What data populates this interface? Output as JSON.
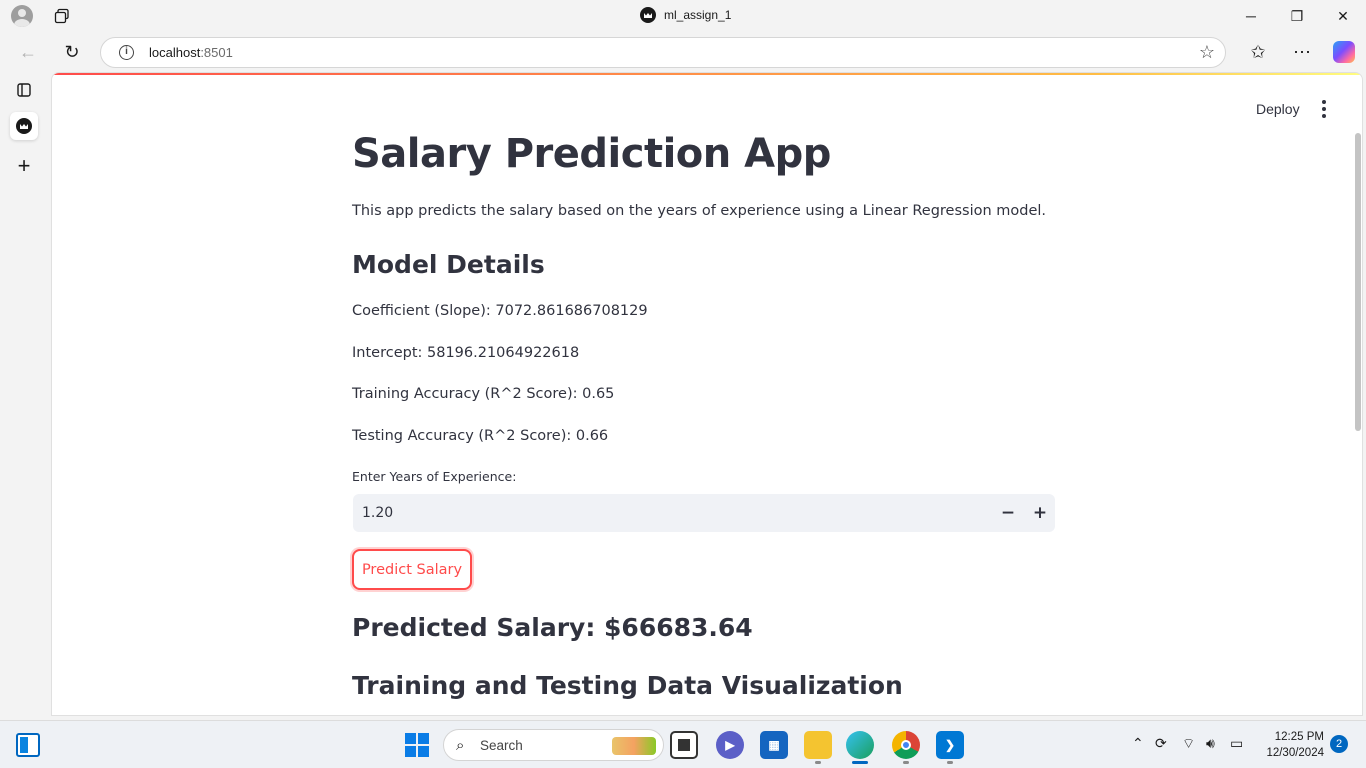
{
  "browser": {
    "tab_title": "ml_assign_1",
    "url_host": "localhost",
    "url_port": ":8501",
    "minimize": "─",
    "restore": "❐",
    "close": "✕"
  },
  "app": {
    "deploy_label": "Deploy",
    "title": "Salary Prediction App",
    "description": "This app predicts the salary based on the years of experience using a Linear Regression model.",
    "model_heading": "Model Details",
    "coefficient": "Coefficient (Slope): 7072.861686708129",
    "intercept": "Intercept: 58196.21064922618",
    "train_acc": "Training Accuracy (R^2 Score): 0.65",
    "test_acc": "Testing Accuracy (R^2 Score): 0.66",
    "input_label": "Enter Years of Experience:",
    "input_value": "1.20",
    "minus": "−",
    "plus": "+",
    "predict_button": "Predict Salary",
    "result": "Predicted Salary: $66683.64",
    "viz_heading": "Training and Testing Data Visualization"
  },
  "taskbar": {
    "search_label": "Search",
    "time": "12:25 PM",
    "date": "12/30/2024",
    "notifications": "2"
  }
}
